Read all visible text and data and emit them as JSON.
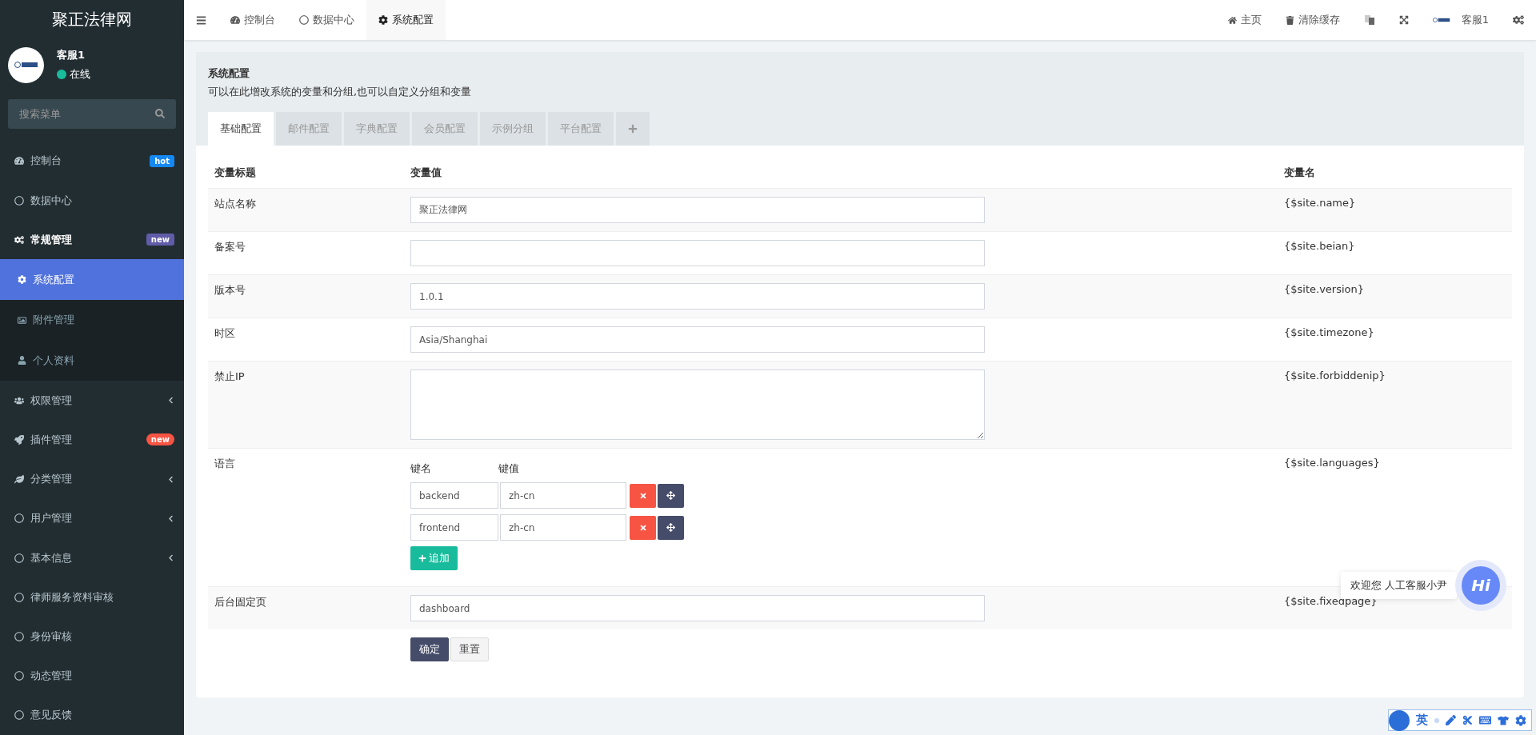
{
  "sidebar": {
    "brand": "聚正法律网",
    "user": {
      "name": "客服1",
      "status": "在线",
      "online": true
    },
    "search": {
      "placeholder": "搜索菜单"
    },
    "items": [
      {
        "label": "控制台",
        "selected": false,
        "badge": {
          "text": "hot",
          "color": "#1688f1"
        }
      },
      {
        "label": "数据中心",
        "selected": false
      },
      {
        "label": "常规管理",
        "selected": false,
        "expanded": true,
        "badge": {
          "text": "new",
          "color": "#605ca8"
        },
        "children": [
          {
            "label": "系统配置",
            "selected": true
          },
          {
            "label": "附件管理",
            "selected": false
          },
          {
            "label": "个人资料",
            "selected": false
          }
        ]
      },
      {
        "label": "权限管理",
        "selected": false,
        "expanded": false
      },
      {
        "label": "插件管理",
        "selected": false,
        "badge": {
          "text": "new",
          "color": "#f75444"
        }
      },
      {
        "label": "分类管理",
        "selected": false,
        "expanded": false
      },
      {
        "label": "用户管理",
        "selected": false,
        "expanded": false
      },
      {
        "label": "基本信息",
        "selected": false,
        "expanded": false
      },
      {
        "label": "律师服务资料审核",
        "selected": false
      },
      {
        "label": "身份审核",
        "selected": false
      },
      {
        "label": "动态管理",
        "selected": false
      },
      {
        "label": "意见反馈",
        "selected": false
      }
    ]
  },
  "topbar": {
    "tabs": [
      {
        "label": "控制台",
        "selected": false
      },
      {
        "label": "数据中心",
        "selected": false
      },
      {
        "label": "系统配置",
        "selected": true
      }
    ],
    "links": [
      "主页",
      "清除缓存"
    ],
    "user": "客服1"
  },
  "page": {
    "title": "系统配置",
    "description": "可以在此增改系统的变量和分组,也可以自定义分组和变量",
    "tabs": [
      {
        "label": "基础配置",
        "selected": true
      },
      {
        "label": "邮件配置",
        "selected": false
      },
      {
        "label": "字典配置",
        "selected": false
      },
      {
        "label": "会员配置",
        "selected": false
      },
      {
        "label": "示例分组",
        "selected": false
      },
      {
        "label": "平台配置",
        "selected": false
      }
    ],
    "table": {
      "columns": [
        "变量标题",
        "变量值",
        "变量名"
      ],
      "rows": [
        {
          "kind": "text",
          "title": "站点名称",
          "value": "聚正法律网",
          "var": "{$site.name}"
        },
        {
          "kind": "text",
          "title": "备案号",
          "value": "",
          "var": "{$site.beian}"
        },
        {
          "kind": "text",
          "title": "版本号",
          "value": "1.0.1",
          "var": "{$site.version}"
        },
        {
          "kind": "text",
          "title": "时区",
          "value": "Asia/Shanghai",
          "var": "{$site.timezone}"
        },
        {
          "kind": "textarea",
          "title": "禁止IP",
          "value": "",
          "var": "{$site.forbiddenip}"
        },
        {
          "kind": "array",
          "title": "语言",
          "key_label": "键名",
          "value_label": "键值",
          "pairs": [
            {
              "key": "backend",
              "value": "zh-cn"
            },
            {
              "key": "frontend",
              "value": "zh-cn"
            }
          ],
          "add_label": "追加",
          "var": "{$site.languages}"
        },
        {
          "kind": "text",
          "title": "后台固定页",
          "value": "dashboard",
          "var": "{$site.fixedpage}"
        }
      ]
    },
    "buttons": [
      {
        "label": "确定",
        "kind": "primary"
      },
      {
        "label": "重置",
        "kind": "default"
      }
    ]
  },
  "chat": {
    "greeting": "欢迎您 人工客服小尹",
    "badge": "Hi"
  },
  "ime": {
    "mode": "英"
  }
}
